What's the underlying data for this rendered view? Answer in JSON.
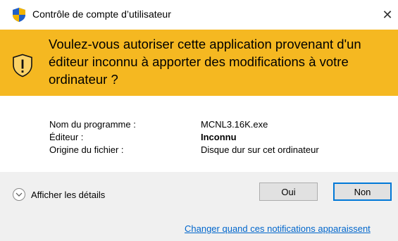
{
  "window": {
    "title": "Contrôle de compte d’utilisateur",
    "close_glyph": "✕"
  },
  "banner": {
    "question": "Voulez-vous autoriser cette application provenant d'un éditeur inconnu à apporter des modifications à votre ordinateur ?",
    "icon": "uac-warning-shield-icon",
    "color": "#f5b821"
  },
  "details": {
    "program_label": "Nom du programme :",
    "program_value": "MCNL3.16K.exe",
    "publisher_label": "Éditeur :",
    "publisher_value": "Inconnu",
    "origin_label": "Origine du fichier :",
    "origin_value": "Disque dur sur cet ordinateur"
  },
  "footer": {
    "show_details_label": "Afficher les détails",
    "yes_label": "Oui",
    "no_label": "Non",
    "change_link": "Changer quand ces notifications apparaissent",
    "accent_color": "#0078d7"
  }
}
